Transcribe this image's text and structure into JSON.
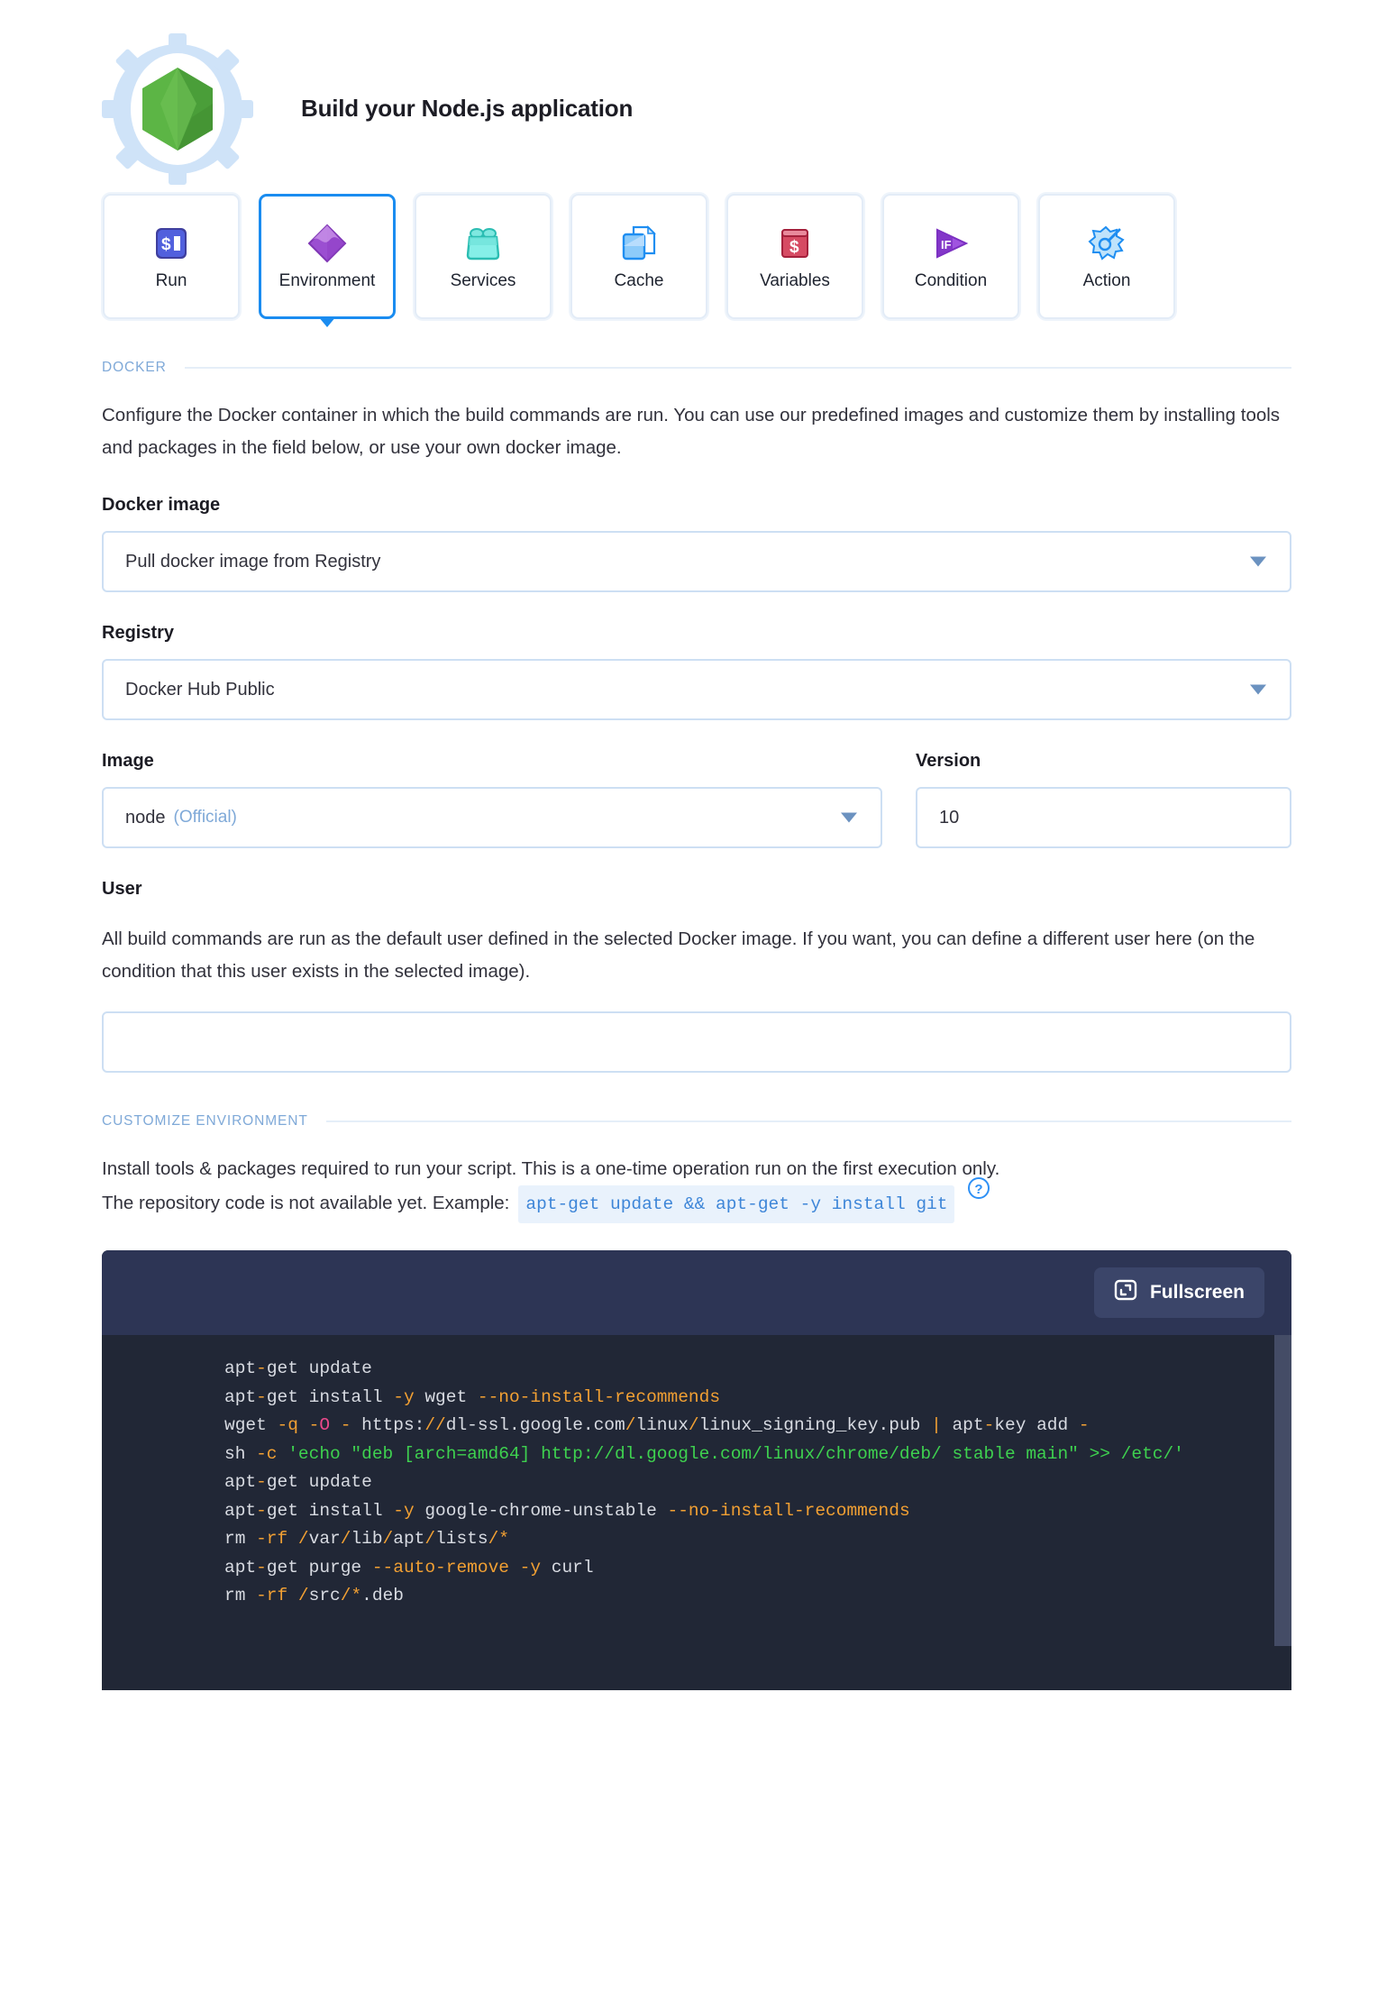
{
  "header": {
    "title": "Build your Node.js application",
    "logo_icon": "nodejs-gear-icon"
  },
  "tabs": [
    {
      "label": "Run",
      "icon": "terminal-prompt-icon",
      "active": false
    },
    {
      "label": "Environment",
      "icon": "diamond-icon",
      "active": true
    },
    {
      "label": "Services",
      "icon": "services-container-icon",
      "active": false
    },
    {
      "label": "Cache",
      "icon": "cache-files-icon",
      "active": false
    },
    {
      "label": "Variables",
      "icon": "variables-dollar-icon",
      "active": false
    },
    {
      "label": "Condition",
      "icon": "if-play-icon",
      "active": false
    },
    {
      "label": "Action",
      "icon": "action-wand-icon",
      "active": false
    }
  ],
  "docker_section": {
    "heading": "DOCKER",
    "description": "Configure the Docker container in which the build commands are run. You can use our predefined images and customize them by installing tools and packages in the field below, or use your own docker image.",
    "docker_image": {
      "label": "Docker image",
      "value": "Pull docker image from Registry"
    },
    "registry": {
      "label": "Registry",
      "value": "Docker Hub Public"
    },
    "image": {
      "label": "Image",
      "value": "node",
      "badge": "(Official)"
    },
    "version": {
      "label": "Version",
      "value": "10"
    },
    "user": {
      "label": "User",
      "description": "All build commands are run as the default user defined in the selected Docker image. If you want, you can define a different user here (on the condition that this user exists in the selected image).",
      "value": "",
      "placeholder": ""
    }
  },
  "customize_section": {
    "heading": "CUSTOMIZE ENVIRONMENT",
    "description_line1": "Install tools & packages required to run your script. This is a one-time operation run on the first execution only.",
    "description_line2": "The repository code is not available yet. Example:",
    "example_code": "apt-get update && apt-get -y install git",
    "help_icon": "help-circle-icon"
  },
  "editor": {
    "fullscreen_label": "Fullscreen",
    "fullscreen_icon": "expand-icon",
    "lines": [
      "apt-get update",
      "apt-get install -y wget --no-install-recommends",
      "wget -q -O - https://dl-ssl.google.com/linux/linux_signing_key.pub | apt-key add -",
      "sh -c 'echo \"deb [arch=amd64] http://dl.google.com/linux/chrome/deb/ stable main\" >> /etc/'",
      "apt-get update",
      "apt-get install -y google-chrome-unstable --no-install-recommends",
      "rm -rf /var/lib/apt/lists/*",
      "apt-get purge --auto-remove -y curl",
      "rm -rf /src/*.deb"
    ]
  },
  "colors": {
    "accent_blue": "#1a8cf0",
    "section_label": "#7fa9d8",
    "editor_bg": "#212736",
    "editor_bar": "#2d3555",
    "code_flag": "#f2a033",
    "code_string": "#3ed14f",
    "code_number": "#e8498a"
  }
}
